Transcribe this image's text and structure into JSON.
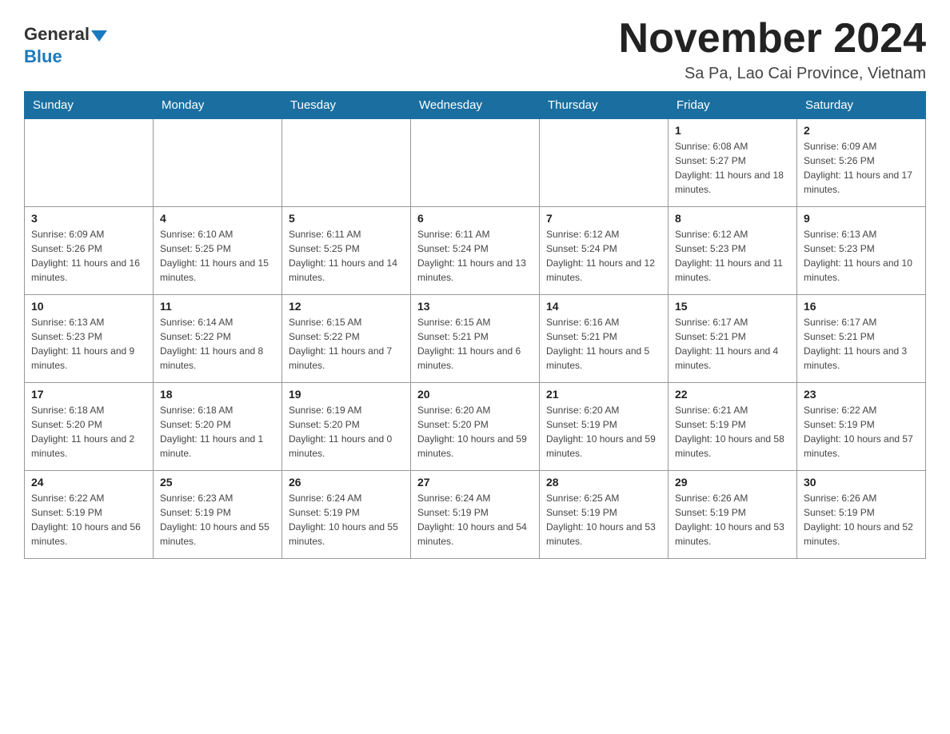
{
  "header": {
    "logo": {
      "general": "General",
      "blue": "Blue",
      "triangle": "▼"
    },
    "title": "November 2024",
    "location": "Sa Pa, Lao Cai Province, Vietnam"
  },
  "calendar": {
    "days_of_week": [
      "Sunday",
      "Monday",
      "Tuesday",
      "Wednesday",
      "Thursday",
      "Friday",
      "Saturday"
    ],
    "weeks": [
      {
        "days": [
          {
            "date": "",
            "info": ""
          },
          {
            "date": "",
            "info": ""
          },
          {
            "date": "",
            "info": ""
          },
          {
            "date": "",
            "info": ""
          },
          {
            "date": "",
            "info": ""
          },
          {
            "date": "1",
            "info": "Sunrise: 6:08 AM\nSunset: 5:27 PM\nDaylight: 11 hours and 18 minutes."
          },
          {
            "date": "2",
            "info": "Sunrise: 6:09 AM\nSunset: 5:26 PM\nDaylight: 11 hours and 17 minutes."
          }
        ]
      },
      {
        "days": [
          {
            "date": "3",
            "info": "Sunrise: 6:09 AM\nSunset: 5:26 PM\nDaylight: 11 hours and 16 minutes."
          },
          {
            "date": "4",
            "info": "Sunrise: 6:10 AM\nSunset: 5:25 PM\nDaylight: 11 hours and 15 minutes."
          },
          {
            "date": "5",
            "info": "Sunrise: 6:11 AM\nSunset: 5:25 PM\nDaylight: 11 hours and 14 minutes."
          },
          {
            "date": "6",
            "info": "Sunrise: 6:11 AM\nSunset: 5:24 PM\nDaylight: 11 hours and 13 minutes."
          },
          {
            "date": "7",
            "info": "Sunrise: 6:12 AM\nSunset: 5:24 PM\nDaylight: 11 hours and 12 minutes."
          },
          {
            "date": "8",
            "info": "Sunrise: 6:12 AM\nSunset: 5:23 PM\nDaylight: 11 hours and 11 minutes."
          },
          {
            "date": "9",
            "info": "Sunrise: 6:13 AM\nSunset: 5:23 PM\nDaylight: 11 hours and 10 minutes."
          }
        ]
      },
      {
        "days": [
          {
            "date": "10",
            "info": "Sunrise: 6:13 AM\nSunset: 5:23 PM\nDaylight: 11 hours and 9 minutes."
          },
          {
            "date": "11",
            "info": "Sunrise: 6:14 AM\nSunset: 5:22 PM\nDaylight: 11 hours and 8 minutes."
          },
          {
            "date": "12",
            "info": "Sunrise: 6:15 AM\nSunset: 5:22 PM\nDaylight: 11 hours and 7 minutes."
          },
          {
            "date": "13",
            "info": "Sunrise: 6:15 AM\nSunset: 5:21 PM\nDaylight: 11 hours and 6 minutes."
          },
          {
            "date": "14",
            "info": "Sunrise: 6:16 AM\nSunset: 5:21 PM\nDaylight: 11 hours and 5 minutes."
          },
          {
            "date": "15",
            "info": "Sunrise: 6:17 AM\nSunset: 5:21 PM\nDaylight: 11 hours and 4 minutes."
          },
          {
            "date": "16",
            "info": "Sunrise: 6:17 AM\nSunset: 5:21 PM\nDaylight: 11 hours and 3 minutes."
          }
        ]
      },
      {
        "days": [
          {
            "date": "17",
            "info": "Sunrise: 6:18 AM\nSunset: 5:20 PM\nDaylight: 11 hours and 2 minutes."
          },
          {
            "date": "18",
            "info": "Sunrise: 6:18 AM\nSunset: 5:20 PM\nDaylight: 11 hours and 1 minute."
          },
          {
            "date": "19",
            "info": "Sunrise: 6:19 AM\nSunset: 5:20 PM\nDaylight: 11 hours and 0 minutes."
          },
          {
            "date": "20",
            "info": "Sunrise: 6:20 AM\nSunset: 5:20 PM\nDaylight: 10 hours and 59 minutes."
          },
          {
            "date": "21",
            "info": "Sunrise: 6:20 AM\nSunset: 5:19 PM\nDaylight: 10 hours and 59 minutes."
          },
          {
            "date": "22",
            "info": "Sunrise: 6:21 AM\nSunset: 5:19 PM\nDaylight: 10 hours and 58 minutes."
          },
          {
            "date": "23",
            "info": "Sunrise: 6:22 AM\nSunset: 5:19 PM\nDaylight: 10 hours and 57 minutes."
          }
        ]
      },
      {
        "days": [
          {
            "date": "24",
            "info": "Sunrise: 6:22 AM\nSunset: 5:19 PM\nDaylight: 10 hours and 56 minutes."
          },
          {
            "date": "25",
            "info": "Sunrise: 6:23 AM\nSunset: 5:19 PM\nDaylight: 10 hours and 55 minutes."
          },
          {
            "date": "26",
            "info": "Sunrise: 6:24 AM\nSunset: 5:19 PM\nDaylight: 10 hours and 55 minutes."
          },
          {
            "date": "27",
            "info": "Sunrise: 6:24 AM\nSunset: 5:19 PM\nDaylight: 10 hours and 54 minutes."
          },
          {
            "date": "28",
            "info": "Sunrise: 6:25 AM\nSunset: 5:19 PM\nDaylight: 10 hours and 53 minutes."
          },
          {
            "date": "29",
            "info": "Sunrise: 6:26 AM\nSunset: 5:19 PM\nDaylight: 10 hours and 53 minutes."
          },
          {
            "date": "30",
            "info": "Sunrise: 6:26 AM\nSunset: 5:19 PM\nDaylight: 10 hours and 52 minutes."
          }
        ]
      }
    ]
  }
}
